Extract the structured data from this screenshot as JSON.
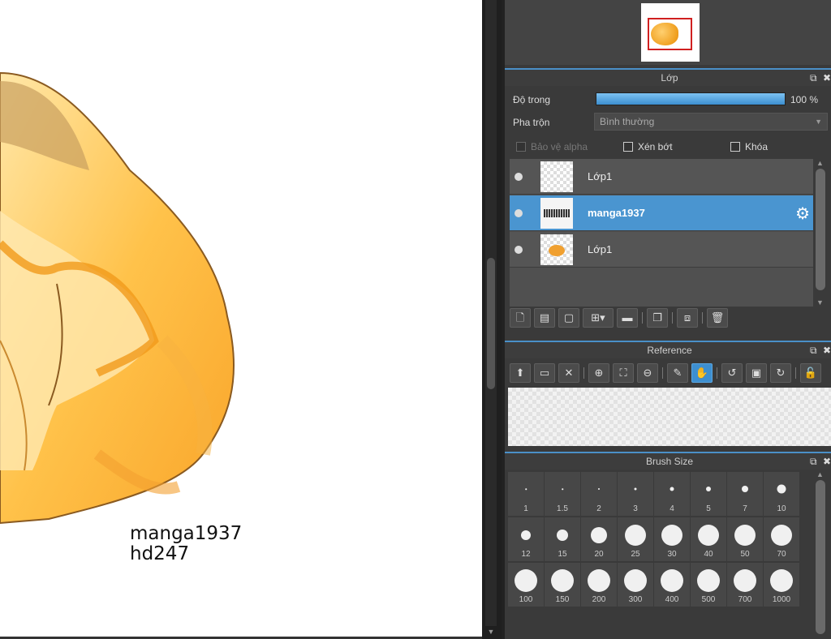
{
  "canvas": {
    "text_lines": [
      "manga1937",
      "hd247"
    ]
  },
  "layer_panel": {
    "title": "Lớp",
    "opacity_label": "Độ trong",
    "opacity_value": "100 %",
    "opacity_fraction": 1.0,
    "blend_label": "Pha trộn",
    "blend_value": "Bình thường",
    "alpha_protect": "Bảo vệ alpha",
    "clipping": "Xén bớt",
    "lock": "Khóa",
    "layers": [
      {
        "name": "Lớp1",
        "selected": false,
        "thumb": "empty"
      },
      {
        "name": "manga1937",
        "selected": true,
        "thumb": "text"
      },
      {
        "name": "Lớp1",
        "selected": false,
        "thumb": "blob"
      }
    ]
  },
  "reference_panel": {
    "title": "Reference"
  },
  "brush_panel": {
    "title": "Brush Size",
    "sizes": [
      "1",
      "1.5",
      "2",
      "3",
      "4",
      "5",
      "7",
      "10",
      "12",
      "15",
      "20",
      "25",
      "30",
      "40",
      "50",
      "70",
      "100",
      "150",
      "200",
      "300",
      "400",
      "500",
      "700",
      "1000"
    ]
  },
  "icons": {
    "undock": "⧉",
    "close": "✖",
    "gear": "⚙"
  }
}
